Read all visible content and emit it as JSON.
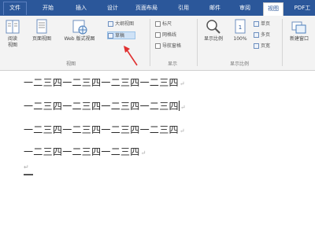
{
  "tabs": [
    "文件",
    "开始",
    "插入",
    "设计",
    "页面布局",
    "引用",
    "邮件",
    "审阅",
    "视图",
    "PDF工"
  ],
  "ribbon": {
    "views_group": {
      "label": "视图",
      "read_mode": "阅读\n视图",
      "print_layout": "页面视图",
      "web_layout": "Web 版式视图",
      "outline": "大纲视图",
      "draft": "草稿"
    },
    "show_group": {
      "label": "显示",
      "ruler": "标尺",
      "gridlines": "网格线",
      "nav_pane": "导航窗格"
    },
    "zoom_group": {
      "label": "显示比例",
      "zoom": "显示比例",
      "hundred": "100%",
      "one_page": "单页",
      "multi_page": "多页",
      "page_width": "页宽"
    },
    "window_group": {
      "new_window": "新建窗口"
    }
  },
  "document": {
    "lines": [
      "一二三四一二三四一二三四一二三四",
      "一二三四一二三四一二三四一二三四",
      "一二三四一二三四一二三四一二三四",
      "一二三四一二三四一二三四"
    ],
    "para_mark": "↵"
  },
  "colors": {
    "accent": "#2b579a",
    "ribbon_bg": "#f3f3f3",
    "highlight": "#cfe2f6",
    "arrow": "#e03030"
  }
}
